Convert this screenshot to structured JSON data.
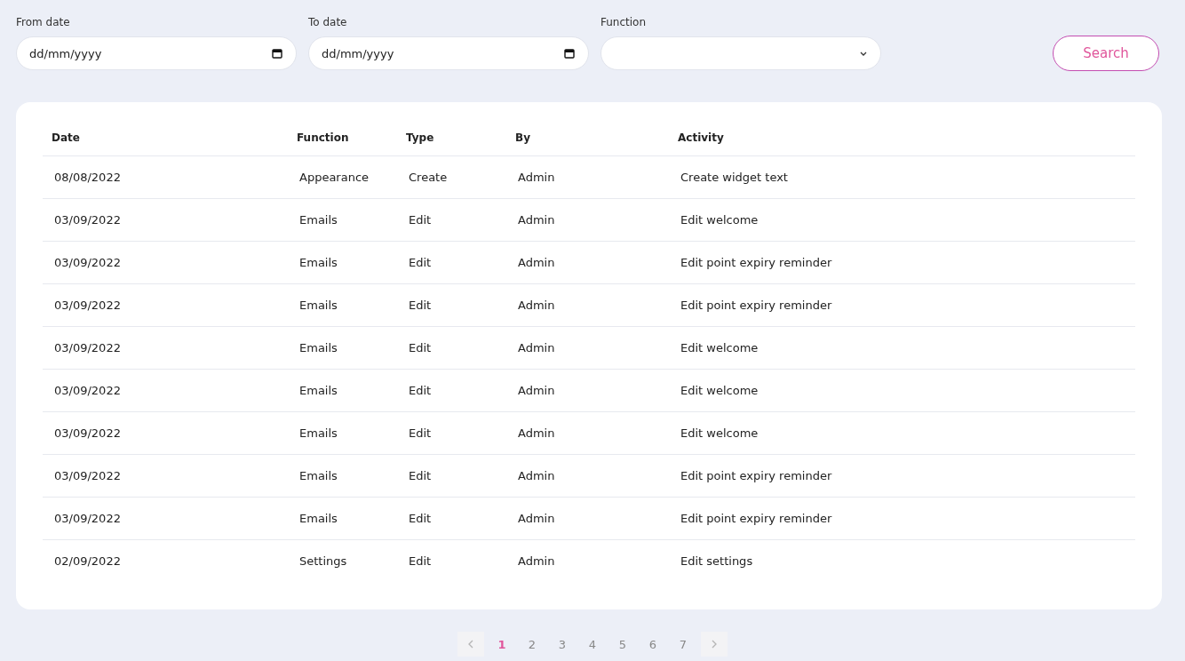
{
  "filters": [
    {
      "kind": "date",
      "label": "From date",
      "placeholder": "dd/mm/yyyy"
    },
    {
      "kind": "date",
      "label": "To date",
      "placeholder": "dd/mm/yyyy"
    },
    {
      "kind": "select",
      "label": "Function"
    }
  ],
  "search_button": "Search",
  "table": {
    "columns": [
      "Date",
      "Function",
      "Type",
      "By",
      "Activity"
    ],
    "rows": [
      [
        "08/08/2022",
        "Appearance",
        "Create",
        "Admin",
        "Create widget text"
      ],
      [
        "03/09/2022",
        "Emails",
        "Edit",
        "Admin",
        "Edit welcome"
      ],
      [
        "03/09/2022",
        "Emails",
        "Edit",
        "Admin",
        "Edit point expiry reminder"
      ],
      [
        "03/09/2022",
        "Emails",
        "Edit",
        "Admin",
        "Edit point expiry reminder"
      ],
      [
        "03/09/2022",
        "Emails",
        "Edit",
        "Admin",
        "Edit welcome"
      ],
      [
        "03/09/2022",
        "Emails",
        "Edit",
        "Admin",
        "Edit welcome"
      ],
      [
        "03/09/2022",
        "Emails",
        "Edit",
        "Admin",
        "Edit welcome"
      ],
      [
        "03/09/2022",
        "Emails",
        "Edit",
        "Admin",
        "Edit point expiry reminder"
      ],
      [
        "03/09/2022",
        "Emails",
        "Edit",
        "Admin",
        "Edit point expiry reminder"
      ],
      [
        "02/09/2022",
        "Settings",
        "Edit",
        "Admin",
        "Edit settings"
      ]
    ]
  },
  "pagination": {
    "pages": [
      {
        "label": "1",
        "selected": true
      },
      {
        "label": "2",
        "selected": false
      },
      {
        "label": "3",
        "selected": false
      },
      {
        "label": "4",
        "selected": false
      },
      {
        "label": "5",
        "selected": false
      },
      {
        "label": "6",
        "selected": false
      },
      {
        "label": "7",
        "selected": false
      }
    ]
  }
}
